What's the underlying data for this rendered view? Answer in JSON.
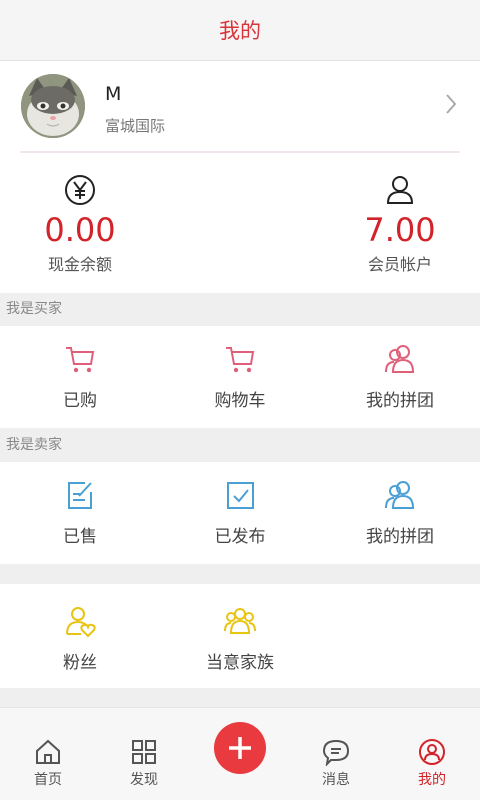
{
  "header": {
    "title": "我的"
  },
  "profile": {
    "name": "M",
    "organization": "富城国际"
  },
  "balances": [
    {
      "amount": "0.00",
      "label": "现金余额",
      "icon": "yen-circle-icon"
    },
    {
      "amount": "7.00",
      "label": "会员帐户",
      "icon": "person-icon"
    }
  ],
  "buyer": {
    "section_label": "我是买家",
    "items": [
      {
        "label": "已购",
        "icon": "cart-icon"
      },
      {
        "label": "购物车",
        "icon": "cart-icon"
      },
      {
        "label": "我的拼团",
        "icon": "group-icon"
      }
    ]
  },
  "seller": {
    "section_label": "我是卖家",
    "items": [
      {
        "label": "已售",
        "icon": "edit-note-icon"
      },
      {
        "label": "已发布",
        "icon": "checkbox-icon"
      },
      {
        "label": "我的拼团",
        "icon": "group-icon"
      }
    ]
  },
  "social": {
    "items": [
      {
        "label": "粉丝",
        "icon": "fan-heart-icon"
      },
      {
        "label": "当意家族",
        "icon": "family-icon"
      }
    ]
  },
  "tabbar": {
    "tabs": [
      {
        "label": "首页",
        "icon": "home-icon"
      },
      {
        "label": "发现",
        "icon": "grid-icon"
      },
      {
        "label": "",
        "icon": "plus-icon"
      },
      {
        "label": "消息",
        "icon": "chat-icon"
      },
      {
        "label": "我的",
        "icon": "user-circle-icon"
      }
    ],
    "active_index": 4
  },
  "colors": {
    "accent": "#d2232a",
    "buyer_icon": "#e0607a",
    "seller_icon": "#4a9fd4",
    "social_icon": "#e8c414"
  }
}
